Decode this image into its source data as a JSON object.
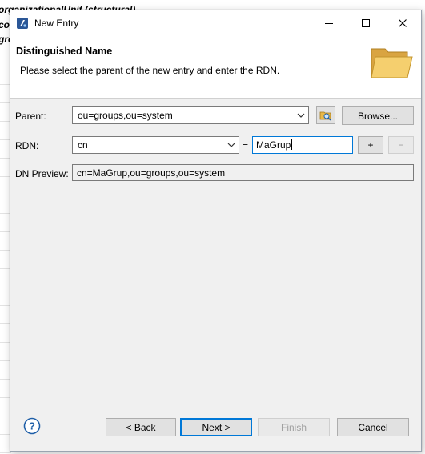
{
  "background": {
    "line1": "organizationalUnit (structural)",
    "line2": "cop",
    "line3": "gro"
  },
  "window": {
    "title": "New Entry",
    "minimize_icon": "minimize-icon",
    "maximize_icon": "maximize-icon",
    "close_icon": "close-icon"
  },
  "header": {
    "title": "Distinguished Name",
    "description": "Please select the parent of the new entry and enter the RDN."
  },
  "form": {
    "parent_label": "Parent:",
    "parent_value": "ou=groups,ou=system",
    "browse_label": "Browse...",
    "rdn_label": "RDN:",
    "rdn_type_value": "cn",
    "equals": "=",
    "rdn_value": "MaGrup",
    "add_label": "+",
    "remove_label": "−",
    "preview_label": "DN Preview:",
    "preview_value": "cn=MaGrup,ou=groups,ou=system"
  },
  "footer": {
    "back_label": "< Back",
    "next_label": "Next >",
    "finish_label": "Finish",
    "cancel_label": "Cancel"
  },
  "colors": {
    "accent": "#0078d7",
    "panel": "#f0f0f0"
  }
}
